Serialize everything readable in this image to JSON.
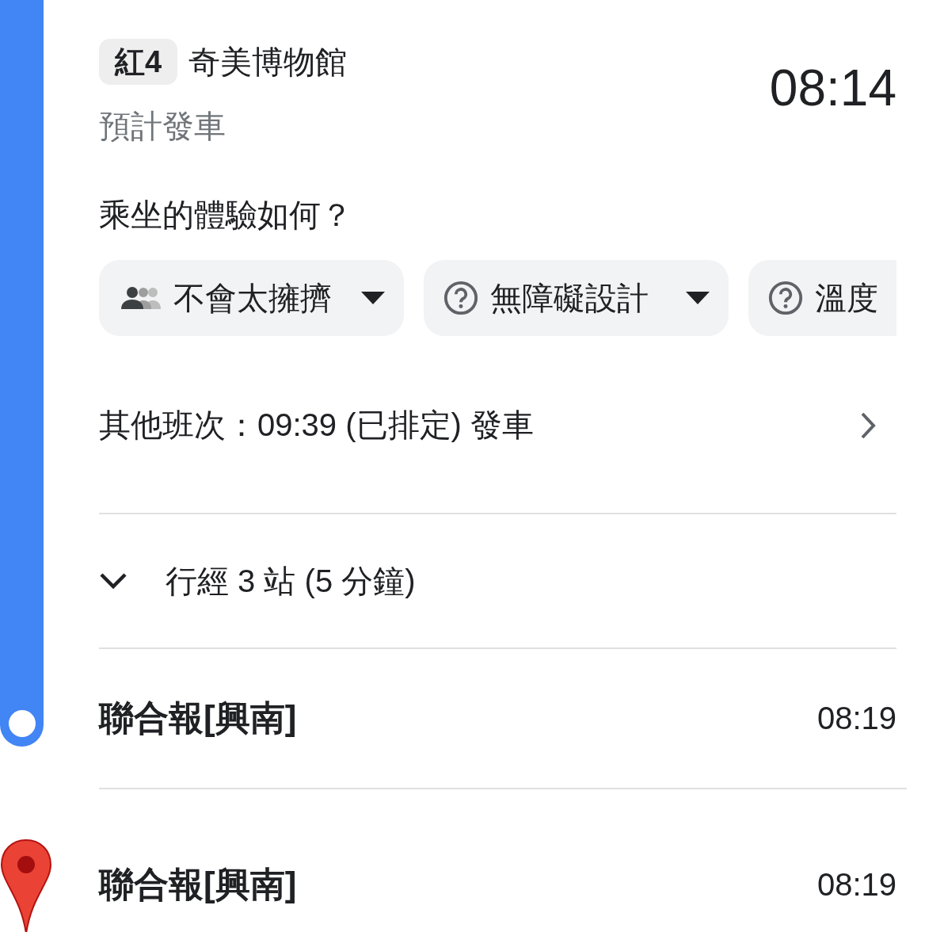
{
  "route": {
    "badge": "紅4",
    "stop": "奇美博物館",
    "status": "預計發車",
    "time": "08:14"
  },
  "feedback": {
    "question": "乘坐的體驗如何？",
    "chips": [
      {
        "kind": "crowd",
        "label": "不會太擁擠",
        "dropdown": true
      },
      {
        "kind": "question",
        "label": "無障礙設計",
        "dropdown": true
      },
      {
        "kind": "question",
        "label": "溫度"
      }
    ]
  },
  "other_trips": "其他班次：09:39 (已排定) 發車",
  "stops_summary": {
    "label": "行經 3 站 (5 分鐘)",
    "expanded": false
  },
  "alight_stop": {
    "name": "聯合報[興南]",
    "time": "08:19"
  },
  "destination": {
    "name": "聯合報[興南]",
    "time": "08:19"
  }
}
